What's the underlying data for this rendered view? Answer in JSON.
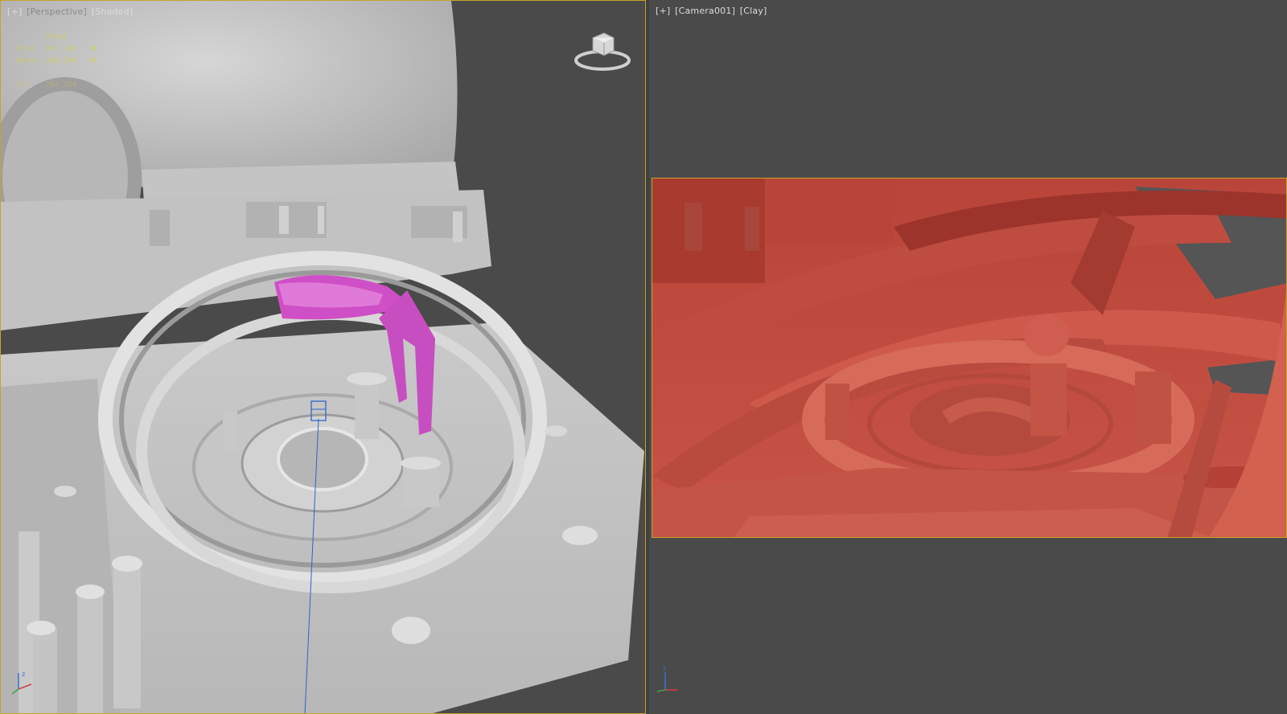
{
  "viewports": {
    "left": {
      "label_plus": "[+]",
      "label_view": "[Perspective]",
      "label_shading": "[Shaded]",
      "stats": {
        "header": "Total",
        "polys_label": "Tris:",
        "polys_value": "957,110",
        "polys_sel": "0",
        "verts_label": "Verts:",
        "verts_value": "286,240",
        "verts_sel": "0",
        "fps_label": "FPS:",
        "fps_value": "264.554"
      }
    },
    "right": {
      "label_plus": "[+]",
      "label_view": "[Camera001]",
      "label_shading": "[Clay]"
    }
  },
  "colors": {
    "viewport_border_active": "#c9a227",
    "viewport_bg": "#4a4a4a",
    "selection_magenta": "#d050c8",
    "clay_red": "#c4473c",
    "stats_yellow": "#d7d23a"
  },
  "icons": {
    "viewcube": "viewcube-icon",
    "axis_tripod": "axis-tripod-icon"
  }
}
